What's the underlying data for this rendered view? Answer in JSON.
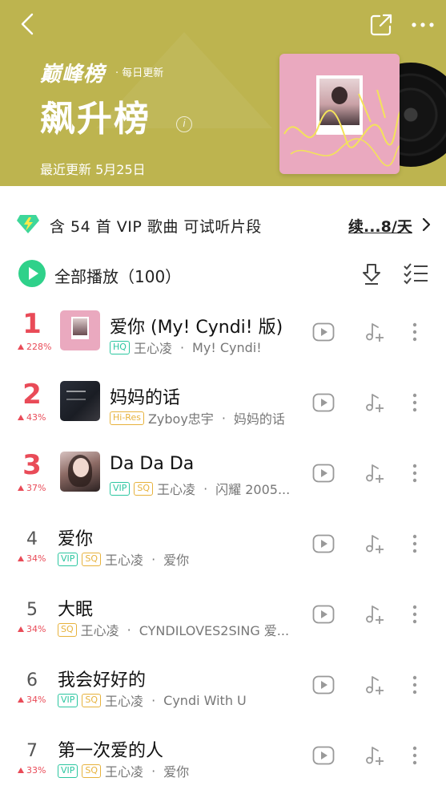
{
  "header": {
    "brand": "巅峰榜",
    "daily": "· 每日更新",
    "title": "飙升榜",
    "update_label": "最近更新 5月25日"
  },
  "vip_bar": {
    "text": "含 54 首 VIP 歌曲 可试听片段",
    "link": "续...8/天"
  },
  "play_all": {
    "label": "全部播放（100）"
  },
  "songs": [
    {
      "rank": "1",
      "change": "228%",
      "title": "爱你 (My! Cyndi! 版)",
      "tags": [
        "HQ"
      ],
      "artist": "王心凌",
      "album": "My! Cyndi!"
    },
    {
      "rank": "2",
      "change": "43%",
      "title": "妈妈的话",
      "tags": [
        "Hi-Res"
      ],
      "artist": "Zyboy忠宇",
      "album": "妈妈的话"
    },
    {
      "rank": "3",
      "change": "37%",
      "title": "Da Da Da",
      "tags": [
        "VIP",
        "SQ"
      ],
      "artist": "王心凌",
      "album": "闪耀 2005..."
    },
    {
      "rank": "4",
      "change": "34%",
      "title": "爱你",
      "tags": [
        "VIP",
        "SQ"
      ],
      "artist": "王心凌",
      "album": "爱你"
    },
    {
      "rank": "5",
      "change": "34%",
      "title": "大眠",
      "tags": [
        "SQ"
      ],
      "artist": "王心凌",
      "album": "CYNDILOVES2SING 爱..."
    },
    {
      "rank": "6",
      "change": "34%",
      "title": "我会好好的",
      "tags": [
        "VIP",
        "SQ"
      ],
      "artist": "王心凌",
      "album": "Cyndi With U"
    },
    {
      "rank": "7",
      "change": "33%",
      "title": "第一次爱的人",
      "tags": [
        "VIP",
        "SQ"
      ],
      "artist": "王心凌",
      "album": "爱你"
    }
  ],
  "colors": {
    "header_bg": "#bdb44f",
    "rank_top": "#e94b58",
    "play_green": "#2fd18a",
    "tag_green": "#2cc6a0",
    "tag_gold": "#e7b23c"
  },
  "icons": [
    "back-icon",
    "share-icon",
    "more-icon",
    "info-icon",
    "diamond-icon",
    "chevron-right-icon",
    "play-icon",
    "download-icon",
    "multi-select-icon",
    "mv-play-icon",
    "add-to-playlist-icon",
    "more-vertical-icon"
  ]
}
